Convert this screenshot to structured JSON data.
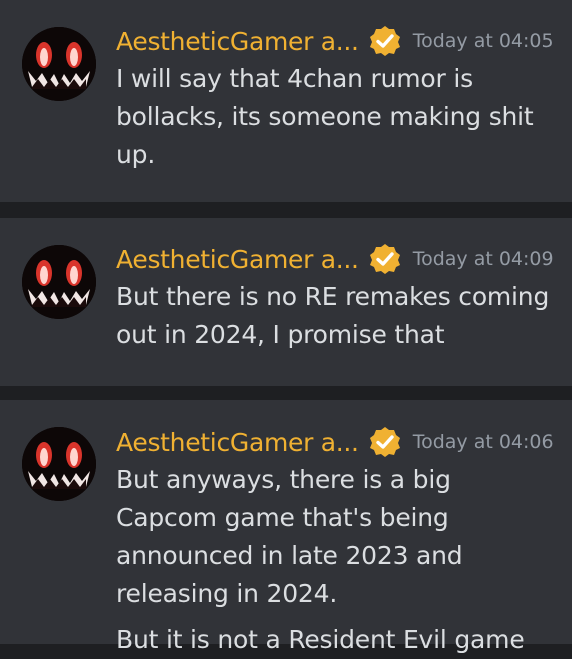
{
  "colors": {
    "background": "#1e1f22",
    "card": "#313338",
    "username": "#f0b132",
    "timestamp": "#949ba4",
    "text": "#dbdee1",
    "badge": "#f0b132"
  },
  "messages": [
    {
      "author": "AestheticGamer a...",
      "badge_icon": "verified-check-icon",
      "timestamp": "Today at 04:05",
      "lines": [
        "I will say that 4chan rumor is bollacks, its someone making shit up."
      ]
    },
    {
      "author": "AestheticGamer a...",
      "badge_icon": "verified-check-icon",
      "timestamp": "Today at 04:09",
      "lines": [
        "But there is no RE remakes coming out in 2024, I promise that"
      ]
    },
    {
      "author": "AestheticGamer a...",
      "badge_icon": "verified-check-icon",
      "timestamp": "Today at 04:06",
      "lines": [
        "But anyways, there is a big Capcom game that's being announced in late 2023 and releasing in 2024.",
        "But it is not a Resident Evil game"
      ]
    }
  ]
}
